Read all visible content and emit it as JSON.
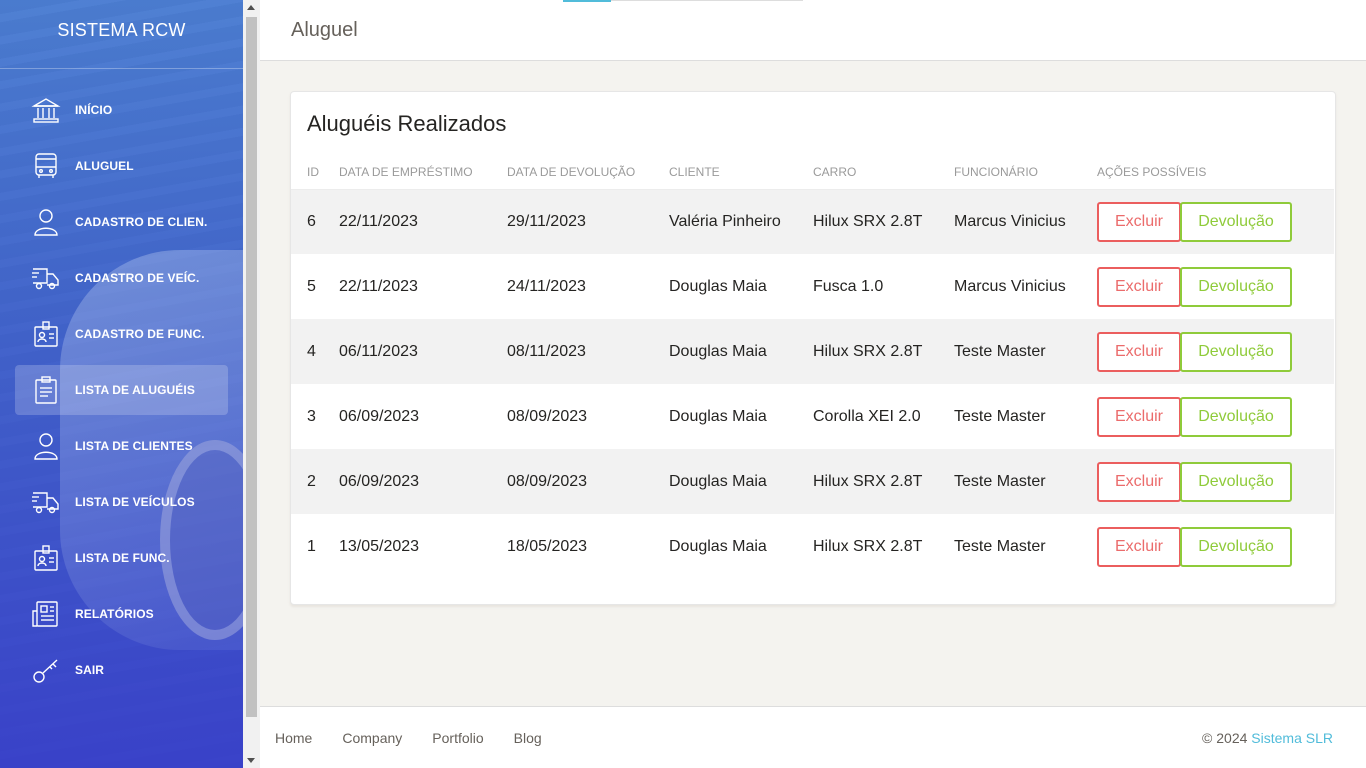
{
  "sidebar": {
    "brand": "SISTEMA RCW",
    "items": [
      {
        "label": "INÍCIO",
        "icon": "bank-icon"
      },
      {
        "label": "ALUGUEL",
        "icon": "bus-icon"
      },
      {
        "label": "CADASTRO DE CLIEN.",
        "icon": "user-icon"
      },
      {
        "label": "CADASTRO DE VEÍC.",
        "icon": "delivery-truck-icon"
      },
      {
        "label": "CADASTRO DE FUNC.",
        "icon": "badge-icon"
      },
      {
        "label": "LISTA DE ALUGUÉIS",
        "icon": "clipboard-icon",
        "active": true
      },
      {
        "label": "LISTA DE CLIENTES",
        "icon": "user-icon"
      },
      {
        "label": "LISTA DE VEÍCULOS",
        "icon": "delivery-truck-icon"
      },
      {
        "label": "LISTA DE FUNC.",
        "icon": "badge-icon"
      },
      {
        "label": "RELATÓRIOS",
        "icon": "report-icon"
      },
      {
        "label": "SAIR",
        "icon": "key-icon"
      }
    ]
  },
  "header": {
    "title": "Aluguel"
  },
  "card": {
    "title": "Aluguéis Realizados",
    "columns": [
      "ID",
      "DATA DE EMPRÉSTIMO",
      "DATA DE DEVOLUÇÃO",
      "CLIENTE",
      "CARRO",
      "FUNCIONÁRIO",
      "AÇÕES POSSÍVEIS"
    ],
    "rows": [
      {
        "id": "6",
        "emprestimo": "22/11/2023",
        "devolucao": "29/11/2023",
        "cliente": "Valéria Pinheiro",
        "carro": "Hilux SRX 2.8T",
        "funcionario": "Marcus Vinicius"
      },
      {
        "id": "5",
        "emprestimo": "22/11/2023",
        "devolucao": "24/11/2023",
        "cliente": "Douglas Maia",
        "carro": "Fusca 1.0",
        "funcionario": "Marcus Vinicius"
      },
      {
        "id": "4",
        "emprestimo": "06/11/2023",
        "devolucao": "08/11/2023",
        "cliente": "Douglas Maia",
        "carro": "Hilux SRX 2.8T",
        "funcionario": "Teste Master"
      },
      {
        "id": "3",
        "emprestimo": "06/09/2023",
        "devolucao": "08/09/2023",
        "cliente": "Douglas Maia",
        "carro": "Corolla XEI 2.0",
        "funcionario": "Teste Master"
      },
      {
        "id": "2",
        "emprestimo": "06/09/2023",
        "devolucao": "08/09/2023",
        "cliente": "Douglas Maia",
        "carro": "Hilux SRX 2.8T",
        "funcionario": "Teste Master"
      },
      {
        "id": "1",
        "emprestimo": "13/05/2023",
        "devolucao": "18/05/2023",
        "cliente": "Douglas Maia",
        "carro": "Hilux SRX 2.8T",
        "funcionario": "Teste Master"
      }
    ],
    "actions": {
      "delete": "Excluir",
      "return": "Devolução"
    }
  },
  "footer": {
    "links": [
      "Home",
      "Company",
      "Portfolio",
      "Blog"
    ],
    "copyright": "© 2024",
    "brand": "Sistema SLR"
  },
  "colors": {
    "accent": "#51bcda",
    "danger": "#eb5e5e",
    "success": "#8fcb3a"
  }
}
